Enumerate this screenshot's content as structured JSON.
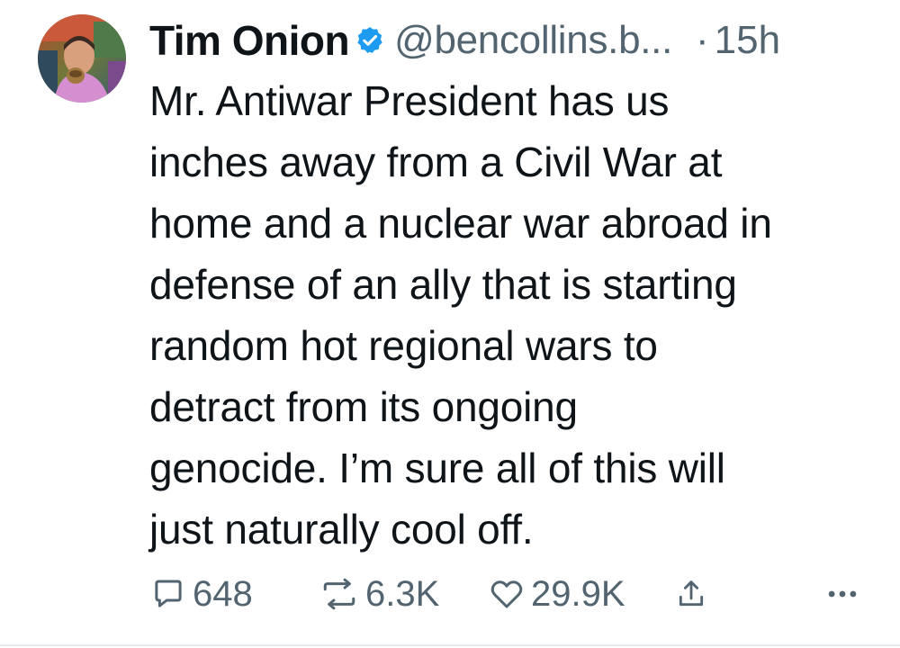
{
  "author": {
    "display_name": "Tim Onion",
    "handle": "@bencollins.b...",
    "separator": "·",
    "time": "15h",
    "verified_color": "#1d9bf0"
  },
  "post": {
    "lines": [
      "Mr. Antiwar President has us",
      "inches away from a Civil War at",
      "home and a nuclear war abroad in",
      "defense of an ally that is starting",
      "random hot regional wars to",
      "detract from its ongoing",
      "genocide. I’m sure all of this will",
      "just naturally cool off."
    ]
  },
  "actions": {
    "reply": {
      "icon": "comment-icon",
      "count": "648"
    },
    "repost": {
      "icon": "repost-icon",
      "count": "6.3K"
    },
    "like": {
      "icon": "heart-icon",
      "count": "29.9K"
    },
    "share": {
      "icon": "share-icon"
    },
    "more": {
      "icon": "more-icon",
      "label": "•••"
    }
  },
  "colors": {
    "text": "#0f1419",
    "secondary": "#536471",
    "divider": "#e6ecf0"
  }
}
